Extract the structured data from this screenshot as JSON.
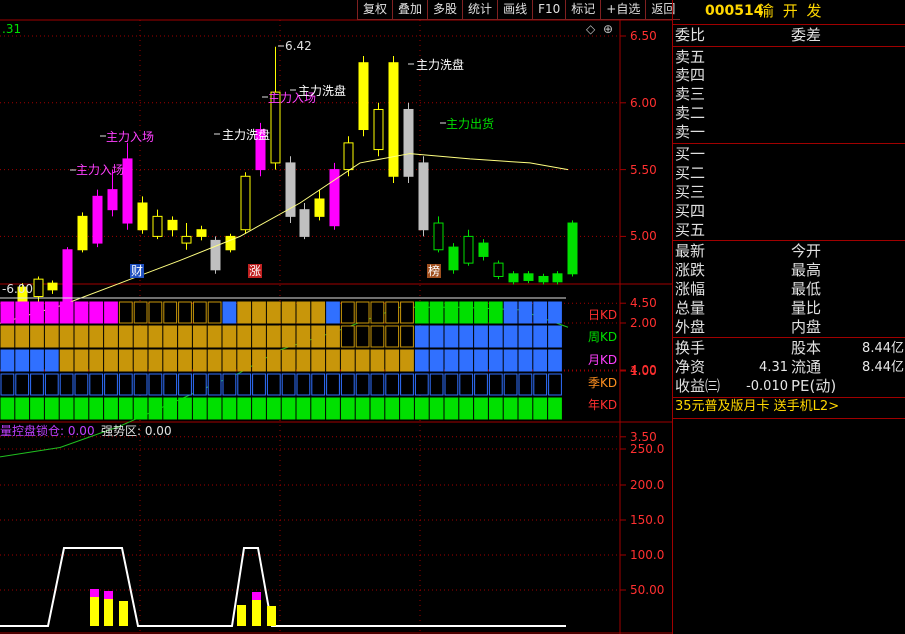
{
  "toolbar": [
    "复权",
    "叠加",
    "多股",
    "统计",
    "画线",
    "F10",
    "标记",
    "+自选",
    "返回"
  ],
  "stock": {
    "code": "000514",
    "name": "渝 开 发"
  },
  "book": {
    "wei_bi": "委比",
    "wei_cha": "委差",
    "sell": [
      "卖五",
      "卖四",
      "卖三",
      "卖二",
      "卖一"
    ],
    "buy": [
      "买一",
      "买二",
      "买三",
      "买四",
      "买五"
    ]
  },
  "quote_labels": {
    "left": [
      "最新",
      "涨跌",
      "涨幅",
      "总量",
      "外盘"
    ],
    "right": [
      "今开",
      "最高",
      "最低",
      "量比",
      "内盘"
    ]
  },
  "fin": {
    "huanshou": "换手",
    "guben": "股本",
    "guben_val": "8.44亿",
    "jingzi": "净资",
    "jingzi_val": "4.31",
    "liutong": "流通",
    "liutong_val": "8.44亿",
    "shouyi": "收益㈢",
    "shouyi_val": "-0.010",
    "pe": "PE(动)"
  },
  "promo": "35元普及版月卡 送手机L2>",
  "price_axis": [
    "6.50",
    "6.00",
    "5.50",
    "5.00",
    "4.50",
    "4.00",
    "3.50"
  ],
  "kd_axis": [
    "2.00",
    "1.00"
  ],
  "vol_axis": [
    "250.0",
    "200.0",
    "150.0",
    "100.0",
    "50.00"
  ],
  "top_left_value": ".31",
  "high_label": "6.42",
  "annotations": {
    "ruchang1": "主力入场",
    "ruchang2": "主力入场",
    "ruchang3": "主力入场",
    "xipan1": "主力洗盘",
    "xipan2": "主力洗盘",
    "xipan3": "主力洗盘",
    "chuhuo": "主力出货"
  },
  "markers": [
    "财",
    "涨",
    "榜"
  ],
  "kd_header": "-6.00",
  "kd_labels": [
    "日KD",
    "周KD",
    "月KD",
    "季KD",
    "年KD"
  ],
  "bottom_header": {
    "left": "量控盘锁仓: 0.00",
    "right": "强势区: 0.00"
  },
  "colors": {
    "up": "#ffff00",
    "down": "#c0c0c0",
    "magenta": "#ff00ff",
    "green": "#00e000",
    "blue": "#3070ff",
    "gold": "#c8960a",
    "grid": "#a00000"
  }
}
